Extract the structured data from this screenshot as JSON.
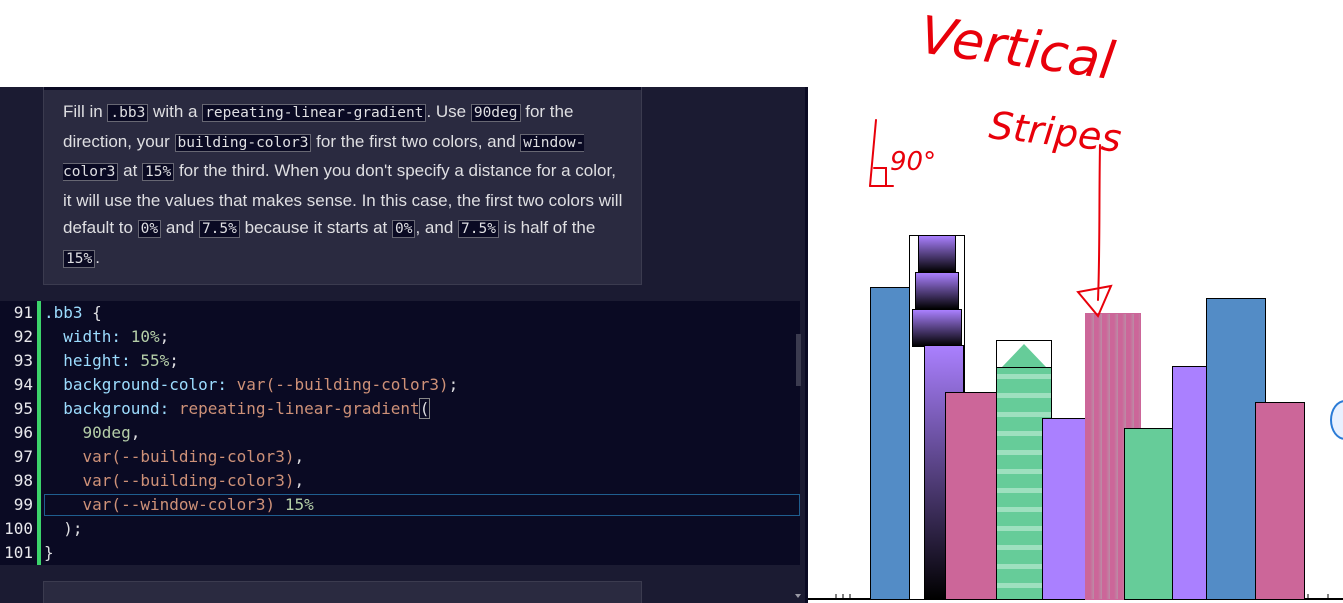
{
  "instructions": {
    "p1": "Fill in ",
    "c1": ".bb3",
    "p2": " with a ",
    "c2": "repeating-linear-gradient",
    "p3": ". Use ",
    "c3": "90deg",
    "p4": " for the direction, your ",
    "c4": "building-color3",
    "p5": " for the first two colors, and ",
    "c5": "window-color3",
    "p6": " at ",
    "c6": "15%",
    "p7": " for the third. When you don't specify a distance for a color, it will use the values that makes sense. In this case, the first two colors will default to ",
    "c7": "0%",
    "p8": " and ",
    "c8": "7.5%",
    "p9": " because it starts at ",
    "c9": "0%",
    "p10": ", and ",
    "c10": "7.5%",
    "p11": " is half of the ",
    "c11": "15%",
    "p12": "."
  },
  "editor": {
    "line_numbers": [
      "91",
      "92",
      "93",
      "94",
      "95",
      "96",
      "97",
      "98",
      "99",
      "100",
      "101"
    ],
    "lines": {
      "l91_sel": ".bb3",
      "l91_rest": " {",
      "l92_prop": "  width:",
      "l92_val": " 10%",
      "l92_end": ";",
      "l93_prop": "  height:",
      "l93_val": " 55%",
      "l93_end": ";",
      "l94_prop": "  background-color:",
      "l94_val": " var(--building-color3)",
      "l94_end": ";",
      "l95_prop": "  background:",
      "l95_val": " repeating-linear-gradient",
      "l95_end": "(",
      "l96_val": "    90deg",
      "l96_end": ",",
      "l97_val": "    var(--building-color3)",
      "l97_end": ",",
      "l98_val": "    var(--building-color3)",
      "l98_end": ",",
      "l99_val": "    var(--window-color3)",
      "l99_num": " 15%",
      "l100": "  );",
      "l101": "}"
    }
  },
  "annotation": {
    "word1": "Vertical",
    "word2": "Stripes",
    "angle": "90°"
  },
  "colors": {
    "building_color1": "#aa80ff",
    "building_color2": "#66cc99",
    "building_color3": "#cc6699",
    "building_color4": "#538cc6",
    "window_color3": "#bb8ca6",
    "annotation_red": "#e8000a"
  }
}
